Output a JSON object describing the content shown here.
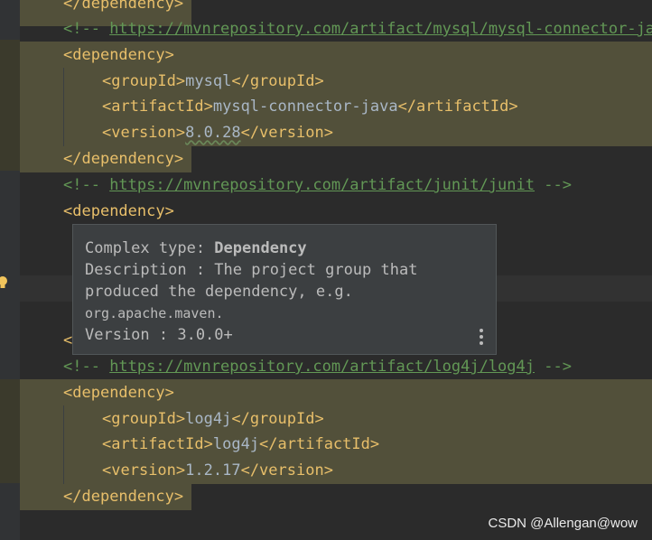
{
  "colors": {
    "background": "#2b2b2b",
    "tag": "#e8bf6a",
    "comment": "#629755",
    "text": "#a9b7c6",
    "highlight": "#52503a"
  },
  "lines": [
    {
      "open": "</",
      "tag": "dependency",
      "close": ">"
    },
    {
      "comment_open": "<!-- ",
      "link": "https://mvnrepository.com/artifact/mysql/mysql-connector-java"
    },
    {
      "open": "<",
      "tag": "dependency",
      "close": ">"
    },
    {
      "open": "<",
      "tag": "groupId",
      "close": ">",
      "value": "mysql",
      "end": "</groupId>"
    },
    {
      "open": "<",
      "tag": "artifactId",
      "close": ">",
      "value": "mysql-connector-java",
      "end": "</artifactId>"
    },
    {
      "open": "<",
      "tag": "version",
      "close": ">",
      "value": "8.0.28",
      "end": "</version>"
    },
    {
      "open": "</",
      "tag": "dependency",
      "close": ">"
    },
    {
      "comment_open": "<!-- ",
      "link": "https://mvnrepository.com/artifact/junit/junit",
      "comment_close": " -->"
    },
    {
      "open": "<",
      "tag": "dependency",
      "close": ">"
    },
    {
      "partial": "<"
    },
    {
      "comment_open": "<!-- ",
      "link": "https://mvnrepository.com/artifact/log4j/log4j",
      "comment_close": " -->"
    },
    {
      "open": "<",
      "tag": "dependency",
      "close": ">"
    },
    {
      "open": "<",
      "tag": "groupId",
      "close": ">",
      "value": "log4j",
      "end": "</groupId>"
    },
    {
      "open": "<",
      "tag": "artifactId",
      "close": ">",
      "value": "log4j",
      "end": "</artifactId>"
    },
    {
      "open": "<",
      "tag": "version",
      "close": ">",
      "value": "1.2.17",
      "end": "</version>"
    },
    {
      "open": "</",
      "tag": "dependency",
      "close": ">"
    }
  ],
  "popup": {
    "type_label": "Complex type: ",
    "type_name": "Dependency",
    "description_line1": "Description : The project group that",
    "description_line2": "produced the dependency, e.g.",
    "description_line3": "org.apache.maven.",
    "version": "Version : 3.0.0+",
    "more_icon": "more-vertical-icon"
  },
  "gutter": {
    "bulb_icon": "lightbulb-icon"
  },
  "watermark": "CSDN @Allengan@wow"
}
